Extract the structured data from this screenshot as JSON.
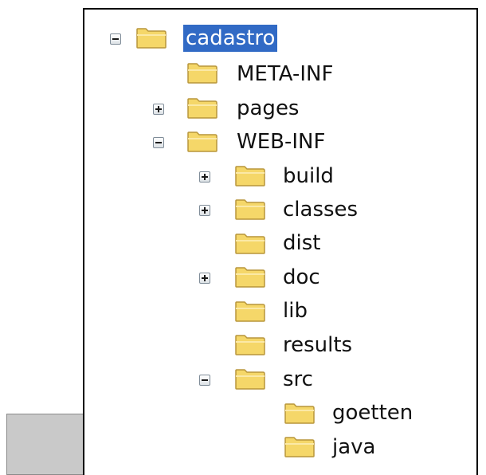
{
  "tree": {
    "nodes": [
      {
        "id": "cadastro",
        "label": "cadastro",
        "toggle": "minus",
        "selected": true
      },
      {
        "id": "meta-inf",
        "label": "META-INF",
        "toggle": "none",
        "selected": false
      },
      {
        "id": "pages",
        "label": "pages",
        "toggle": "plus",
        "selected": false
      },
      {
        "id": "web-inf",
        "label": "WEB-INF",
        "toggle": "minus",
        "selected": false
      },
      {
        "id": "build",
        "label": "build",
        "toggle": "plus",
        "selected": false
      },
      {
        "id": "classes",
        "label": "classes",
        "toggle": "plus",
        "selected": false
      },
      {
        "id": "dist",
        "label": "dist",
        "toggle": "none",
        "selected": false
      },
      {
        "id": "doc",
        "label": "doc",
        "toggle": "plus",
        "selected": false
      },
      {
        "id": "lib",
        "label": "lib",
        "toggle": "none",
        "selected": false
      },
      {
        "id": "results",
        "label": "results",
        "toggle": "none",
        "selected": false
      },
      {
        "id": "src",
        "label": "src",
        "toggle": "minus",
        "selected": false
      },
      {
        "id": "goetten",
        "label": "goetten",
        "toggle": "none",
        "selected": false
      },
      {
        "id": "java",
        "label": "java",
        "toggle": "none",
        "selected": false
      }
    ]
  },
  "colors": {
    "selection": "#316ac5",
    "folder_fill": "#f5d769",
    "folder_border": "#b8963b"
  },
  "icons": {
    "folder": "folder-icon",
    "expand": "expand-plus-icon",
    "collapse": "collapse-minus-icon"
  }
}
